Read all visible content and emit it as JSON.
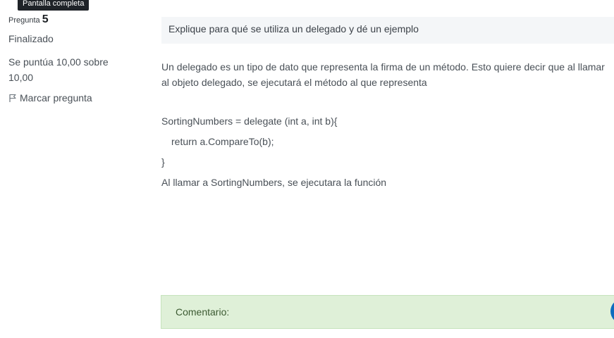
{
  "tooltip": "Pantalla completa",
  "question_info": {
    "label": "Pregunta",
    "number": "5",
    "state": "Finalizado",
    "grade": "Se puntúa 10,00 sobre 10,00",
    "flag_label": "Marcar pregunta"
  },
  "question_text": "Explique para qué se utiliza un delegado y dé un ejemplo",
  "answer": {
    "paragraph": "Un delegado es un tipo de dato que representa la firma de un método. Esto quiere decir que al llamar al objeto delegado, se ejecutará el método al que representa",
    "code_line_1": "SortingNumbers = delegate (int a, int b){",
    "code_line_2": "return a.CompareTo(b);",
    "code_line_3": "}",
    "closing": "Al llamar a SortingNumbers, se ejecutara la función"
  },
  "comment_label": "Comentario:",
  "colors": {
    "comment_bg": "#dff0d8",
    "question_bg": "#f4f6f8",
    "accent": "#0f6cbf"
  }
}
